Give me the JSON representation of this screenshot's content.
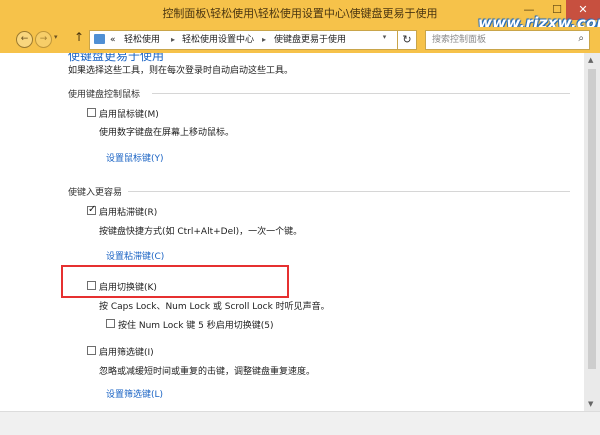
{
  "window": {
    "title": "控制面板\\轻松使用\\轻松使用设置中心\\使键盘更易于使用",
    "minimize_glyph": "—",
    "maximize_glyph": "☐",
    "close_glyph": "✕",
    "watermark": "www.rjzxw.com"
  },
  "navigation": {
    "back_icon": "arrow-left-icon",
    "forward_icon": "arrow-right-icon",
    "up_icon": "arrow-up-icon",
    "address_segments": [
      "«",
      "轻松使用",
      "轻松使用设置中心",
      "使键盘更易于使用"
    ],
    "refresh_icon": "refresh-icon",
    "search_placeholder": "搜索控制面板"
  },
  "content": {
    "heading_partial": "使键盘更易于使用",
    "intro": "如果选择这些工具，则在每次登录时自动启动这些工具。",
    "mouse_section": {
      "title": "使用键盘控制鼠标",
      "checkbox_label": "启用鼠标键(M)",
      "checked": false,
      "description": "使用数字键盘在屏幕上移动鼠标。",
      "setup_link": "设置鼠标键(Y)"
    },
    "typing_section": {
      "title": "使键入更容易",
      "sticky": {
        "label": "启用粘滞键(R)",
        "checked": true,
        "description": "按键盘快捷方式(如 Ctrl+Alt+Del)，一次一个键。",
        "setup_link": "设置粘滞键(C)"
      },
      "toggle": {
        "label": "启用切换键(K)",
        "checked": false,
        "description": "按 Caps Lock、Num Lock 或 Scroll Lock 时听见声音。",
        "sub_label": "按住 Num Lock 键 5 秒启用切换键(5)",
        "sub_checked": false
      },
      "filter": {
        "label": "启用筛选键(I)",
        "checked": false,
        "description": "忽略或减缓短时间或重复的击键，调整键盘重复速度。",
        "setup_link": "设置筛选键(L)"
      }
    }
  },
  "colors": {
    "titlebar": "#f6c24a",
    "link": "#1a63c4",
    "highlight": "#e63030"
  }
}
